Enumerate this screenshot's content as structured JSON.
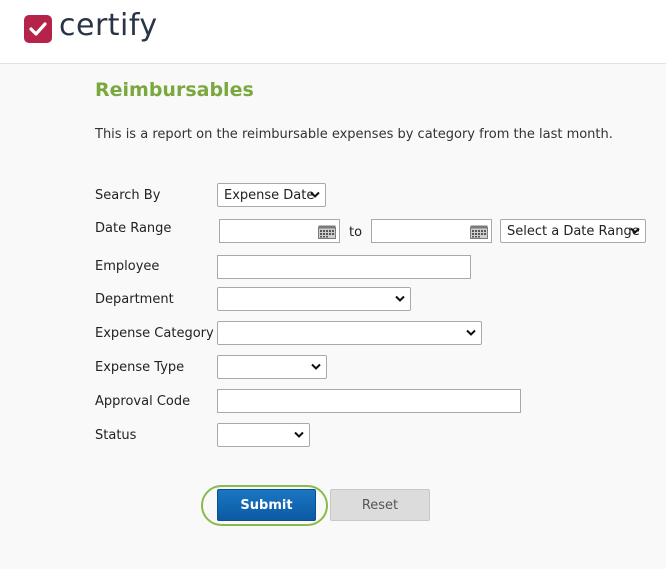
{
  "brand": {
    "name": "certify",
    "colors": {
      "mark": "#b5234b",
      "text": "#2a3446"
    }
  },
  "page": {
    "title": "Reimbursables",
    "description": "This is a report on the reimbursable expenses by category from the last month."
  },
  "form": {
    "search_by": {
      "label": "Search By",
      "value": "Expense Date"
    },
    "date_range": {
      "label": "Date Range",
      "from_value": "",
      "to_label": "to",
      "to_value": "",
      "preset_value": "Select a Date Range"
    },
    "employee": {
      "label": "Employee",
      "value": ""
    },
    "department": {
      "label": "Department",
      "value": ""
    },
    "expense_category": {
      "label": "Expense Category",
      "value": ""
    },
    "expense_type": {
      "label": "Expense Type",
      "value": ""
    },
    "approval_code": {
      "label": "Approval Code",
      "value": ""
    },
    "status": {
      "label": "Status",
      "value": ""
    }
  },
  "actions": {
    "submit_label": "Submit",
    "reset_label": "Reset"
  },
  "colors": {
    "title_green": "#7aa83e",
    "submit_blue": "#0b5aa3",
    "focus_ring": "#8cb94a"
  },
  "icons": {
    "select_arrow": "chevron-down-icon",
    "date_picker": "calendar-icon",
    "logo": "checkmark-icon"
  }
}
